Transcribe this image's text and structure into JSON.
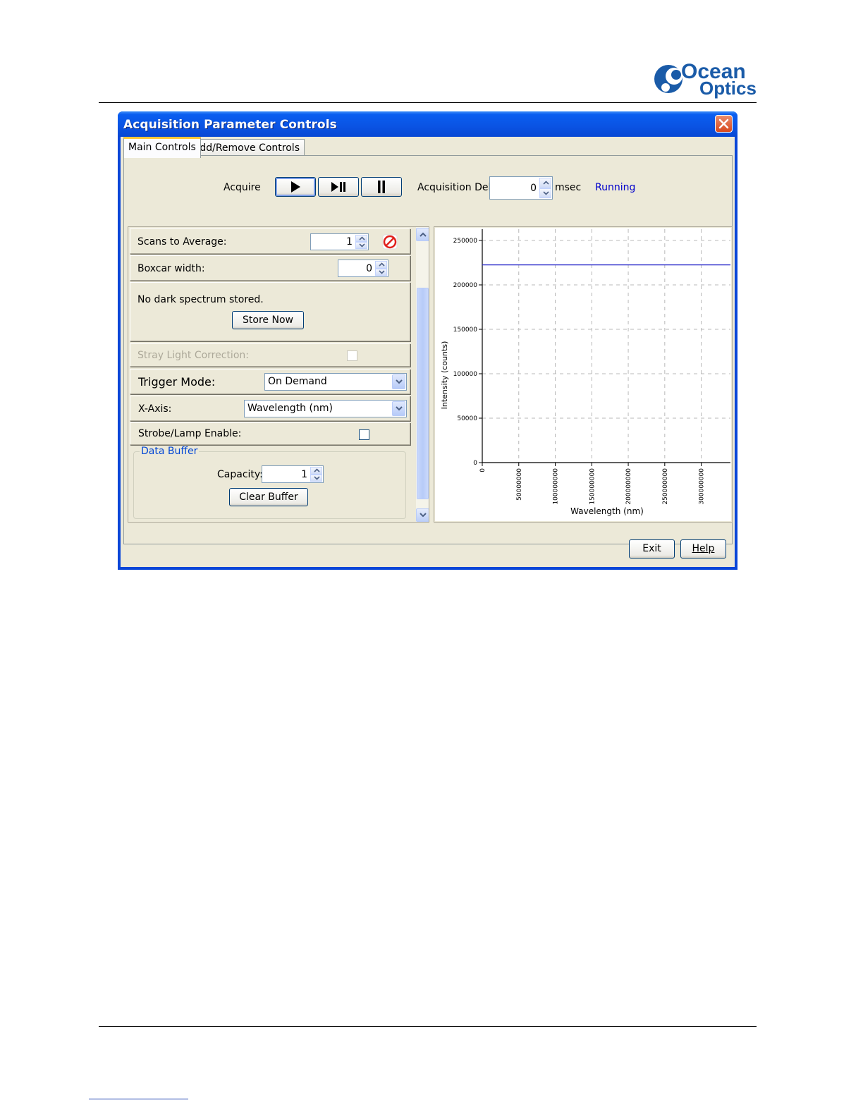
{
  "logo": {
    "line1": "Ocean",
    "line2": "Optics"
  },
  "window": {
    "title": "Acquisition Parameter Controls",
    "tabs": [
      {
        "label": "Main Controls",
        "active": true
      },
      {
        "label": "Add/Remove Controls",
        "active": false
      }
    ]
  },
  "acquire": {
    "label": "Acquire",
    "buttons": [
      {
        "icon": "play-icon",
        "selected": true
      },
      {
        "icon": "step-icon",
        "selected": false
      },
      {
        "icon": "pause-icon",
        "selected": false
      }
    ],
    "delay_label": "Acquisition Delay",
    "delay_value": "0",
    "delay_unit": "msec",
    "status": "Running",
    "status_color": "#0000cc"
  },
  "controls": {
    "scans_label": "Scans to Average:",
    "scans_value": "1",
    "boxcar_label": "Boxcar width:",
    "boxcar_value": "0",
    "dark_message": "No dark spectrum stored.",
    "store_now": "Store Now",
    "stray_label": "Stray Light Correction:",
    "trigger_label": "Trigger Mode:",
    "trigger_value": "On Demand",
    "xaxis_label": "X-Axis:",
    "xaxis_value": "Wavelength (nm)",
    "strobe_label": "Strobe/Lamp Enable:",
    "buffer_title": "Data Buffer",
    "capacity_label": "Capacity:",
    "capacity_value": "1",
    "clear_buffer": "Clear Buffer"
  },
  "chart_data": {
    "type": "line",
    "xlabel": "Wavelength (nm)",
    "ylabel": "Intensity (counts)",
    "xlim": [
      0,
      340000000
    ],
    "ylim": [
      0,
      250000
    ],
    "x_ticks": [
      "0",
      "50000000",
      "100000000",
      "150000000",
      "200000000",
      "250000000",
      "300000000"
    ],
    "x_tick_values": [
      0,
      50000000,
      100000000,
      150000000,
      200000000,
      250000000,
      300000000
    ],
    "y_ticks": [
      "0",
      "50000",
      "100000",
      "150000",
      "200000",
      "250000"
    ],
    "y_tick_values": [
      0,
      50000,
      100000,
      150000,
      200000,
      250000
    ],
    "grid": true,
    "series": [
      {
        "x": [
          0,
          340000000
        ],
        "y": [
          222500,
          222500
        ],
        "color": "#2323c8"
      }
    ]
  },
  "footer": {
    "exit": "Exit",
    "help": "Help"
  }
}
